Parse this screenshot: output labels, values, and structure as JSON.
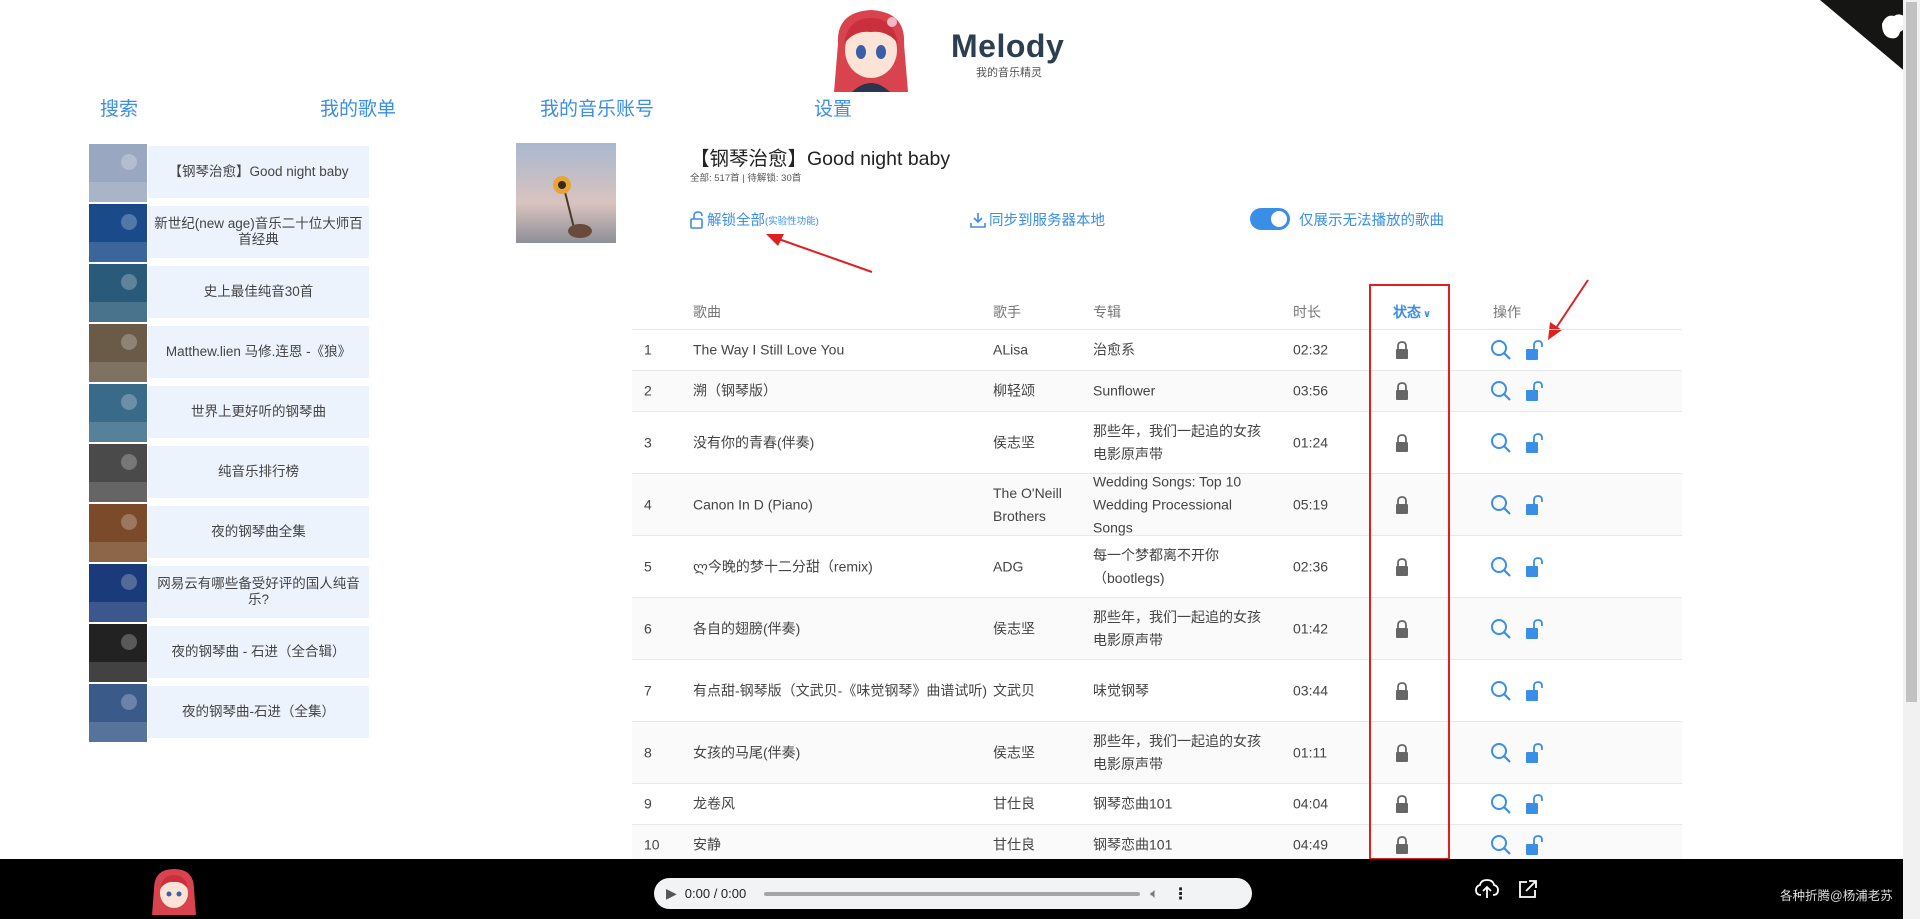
{
  "header": {
    "title": "Melody",
    "subtitle": "我的音乐精灵"
  },
  "nav": [
    "搜索",
    "我的歌单",
    "我的音乐账号",
    "设置"
  ],
  "playlists": [
    {
      "name": "【钢琴治愈】Good night baby",
      "color": "#9aa7c0"
    },
    {
      "name": "新世纪(new age)音乐二十位大师百首经典",
      "color": "#1a4a8a"
    },
    {
      "name": "史上最佳纯音30首",
      "color": "#2a5a7a"
    },
    {
      "name": "Matthew.lien 马修.连恩 -《狼》",
      "color": "#6a5a48"
    },
    {
      "name": "世界上更好听的钢琴曲",
      "color": "#3a6a8a"
    },
    {
      "name": "纯音乐排行榜",
      "color": "#4a4a4a"
    },
    {
      "name": "夜的钢琴曲全集",
      "color": "#7a4a2a"
    },
    {
      "name": "网易云有哪些备受好评的国人纯音乐?",
      "color": "#1a3a7a"
    },
    {
      "name": "夜的钢琴曲 - 石进（全合辑）",
      "color": "#222222"
    },
    {
      "name": "夜的钢琴曲-石进（全集）",
      "color": "#3a5a8a"
    }
  ],
  "detail": {
    "title": "【钢琴治愈】Good night baby",
    "stats": "全部: 517首 | 待解锁: 30首",
    "unlock_all": "解锁全部",
    "unlock_all_note": "(实验性功能)",
    "sync": "同步到服务器本地",
    "toggle_label": "仅展示无法播放的歌曲",
    "toggle_on": true
  },
  "table": {
    "headers": {
      "song": "歌曲",
      "artist": "歌手",
      "album": "专辑",
      "duration": "时长",
      "status": "状态",
      "actions": "操作"
    },
    "rows": [
      {
        "num": "1",
        "song": "The Way I Still Love You",
        "artist": "ALisa",
        "album": "治愈系",
        "duration": "02:32"
      },
      {
        "num": "2",
        "song": "溯（钢琴版）",
        "artist": "柳轻颂",
        "album": "Sunflower",
        "duration": "03:56"
      },
      {
        "num": "3",
        "song": "没有你的青春(伴奏)",
        "artist": "侯志坚",
        "album": "那些年，我们一起追的女孩电影原声带",
        "duration": "01:24"
      },
      {
        "num": "4",
        "song": "Canon In D (Piano)",
        "artist": "The O'Neill Brothers",
        "album": "Wedding Songs: Top 10 Wedding Processional Songs",
        "duration": "05:19"
      },
      {
        "num": "5",
        "song": "ლ今晚的梦十二分甜（remix)",
        "artist": "ADG",
        "album": "每一个梦都离不开你（bootlegs)",
        "duration": "02:36"
      },
      {
        "num": "6",
        "song": "各自的翅膀(伴奏)",
        "artist": "侯志坚",
        "album": "那些年，我们一起追的女孩电影原声带",
        "duration": "01:42"
      },
      {
        "num": "7",
        "song": "有点甜-钢琴版（文武贝-《味觉钢琴》曲谱试听)",
        "artist": "文武贝",
        "album": "味觉钢琴",
        "duration": "03:44"
      },
      {
        "num": "8",
        "song": "女孩的马尾(伴奏)",
        "artist": "侯志坚",
        "album": "那些年，我们一起追的女孩电影原声带",
        "duration": "01:11"
      },
      {
        "num": "9",
        "song": "龙卷风",
        "artist": "甘仕良",
        "album": "钢琴恋曲101",
        "duration": "04:04"
      },
      {
        "num": "10",
        "song": "安静",
        "artist": "甘仕良",
        "album": "钢琴恋曲101",
        "duration": "04:49"
      }
    ]
  },
  "player": {
    "time": "0:00 / 0:00",
    "footer": "各种折腾@杨浦老苏"
  },
  "colors": {
    "accent": "#3a8ee6",
    "highlight": "#e02020",
    "player_bg": "#000000"
  }
}
